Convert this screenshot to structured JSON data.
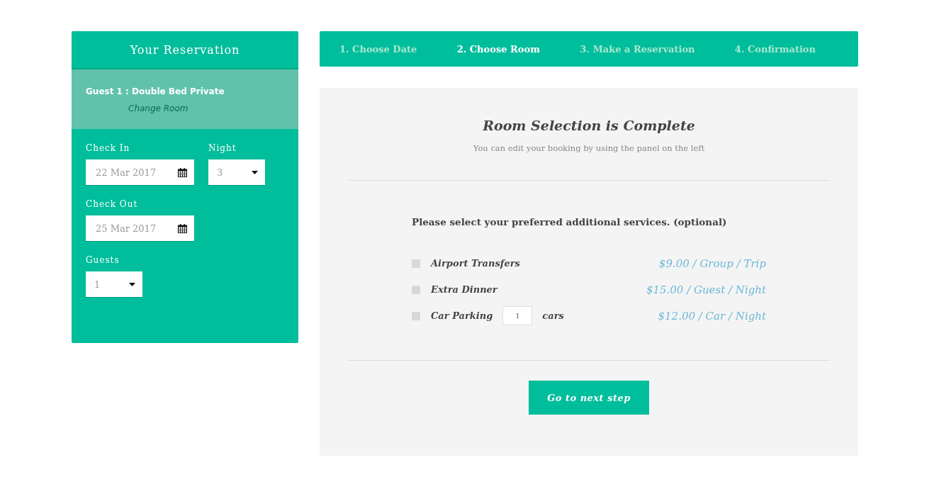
{
  "reservation": {
    "title": "Your Reservation",
    "guest": "Guest 1 : Double Bed Private",
    "change_link": "Change Room",
    "check_in": {
      "label": "Check In",
      "value": "22 Mar 2017"
    },
    "night": {
      "label": "Night",
      "value": "3"
    },
    "check_out": {
      "label": "Check Out",
      "value": "25 Mar 2017"
    },
    "guests": {
      "label": "Guests",
      "value": "1"
    }
  },
  "steps": [
    {
      "label": "1. Choose Date",
      "selected": false
    },
    {
      "label": "2. Choose Room",
      "selected": true
    },
    {
      "label": "3. Make a Reservation",
      "selected": false
    },
    {
      "label": "4. Confirmation",
      "selected": false
    }
  ],
  "content": {
    "heading": "Room Selection is Complete",
    "subheading": "You can edit your booking by using the panel on the left",
    "services_prompt": "Please select your preferred additional services. (optional)",
    "services": [
      {
        "kind": "plain",
        "name": "Airport Transfers",
        "checked": false,
        "price": "$9.00 / Group / Trip"
      },
      {
        "kind": "plain",
        "name": "Extra Dinner",
        "checked": false,
        "price": "$15.00 / Guest / Night"
      },
      {
        "kind": "quantity",
        "name": "Car Parking",
        "checked": false,
        "quantity": "1",
        "unit": "cars",
        "price": "$12.00 / Car / Night"
      }
    ],
    "next_button": "Go to next step"
  }
}
